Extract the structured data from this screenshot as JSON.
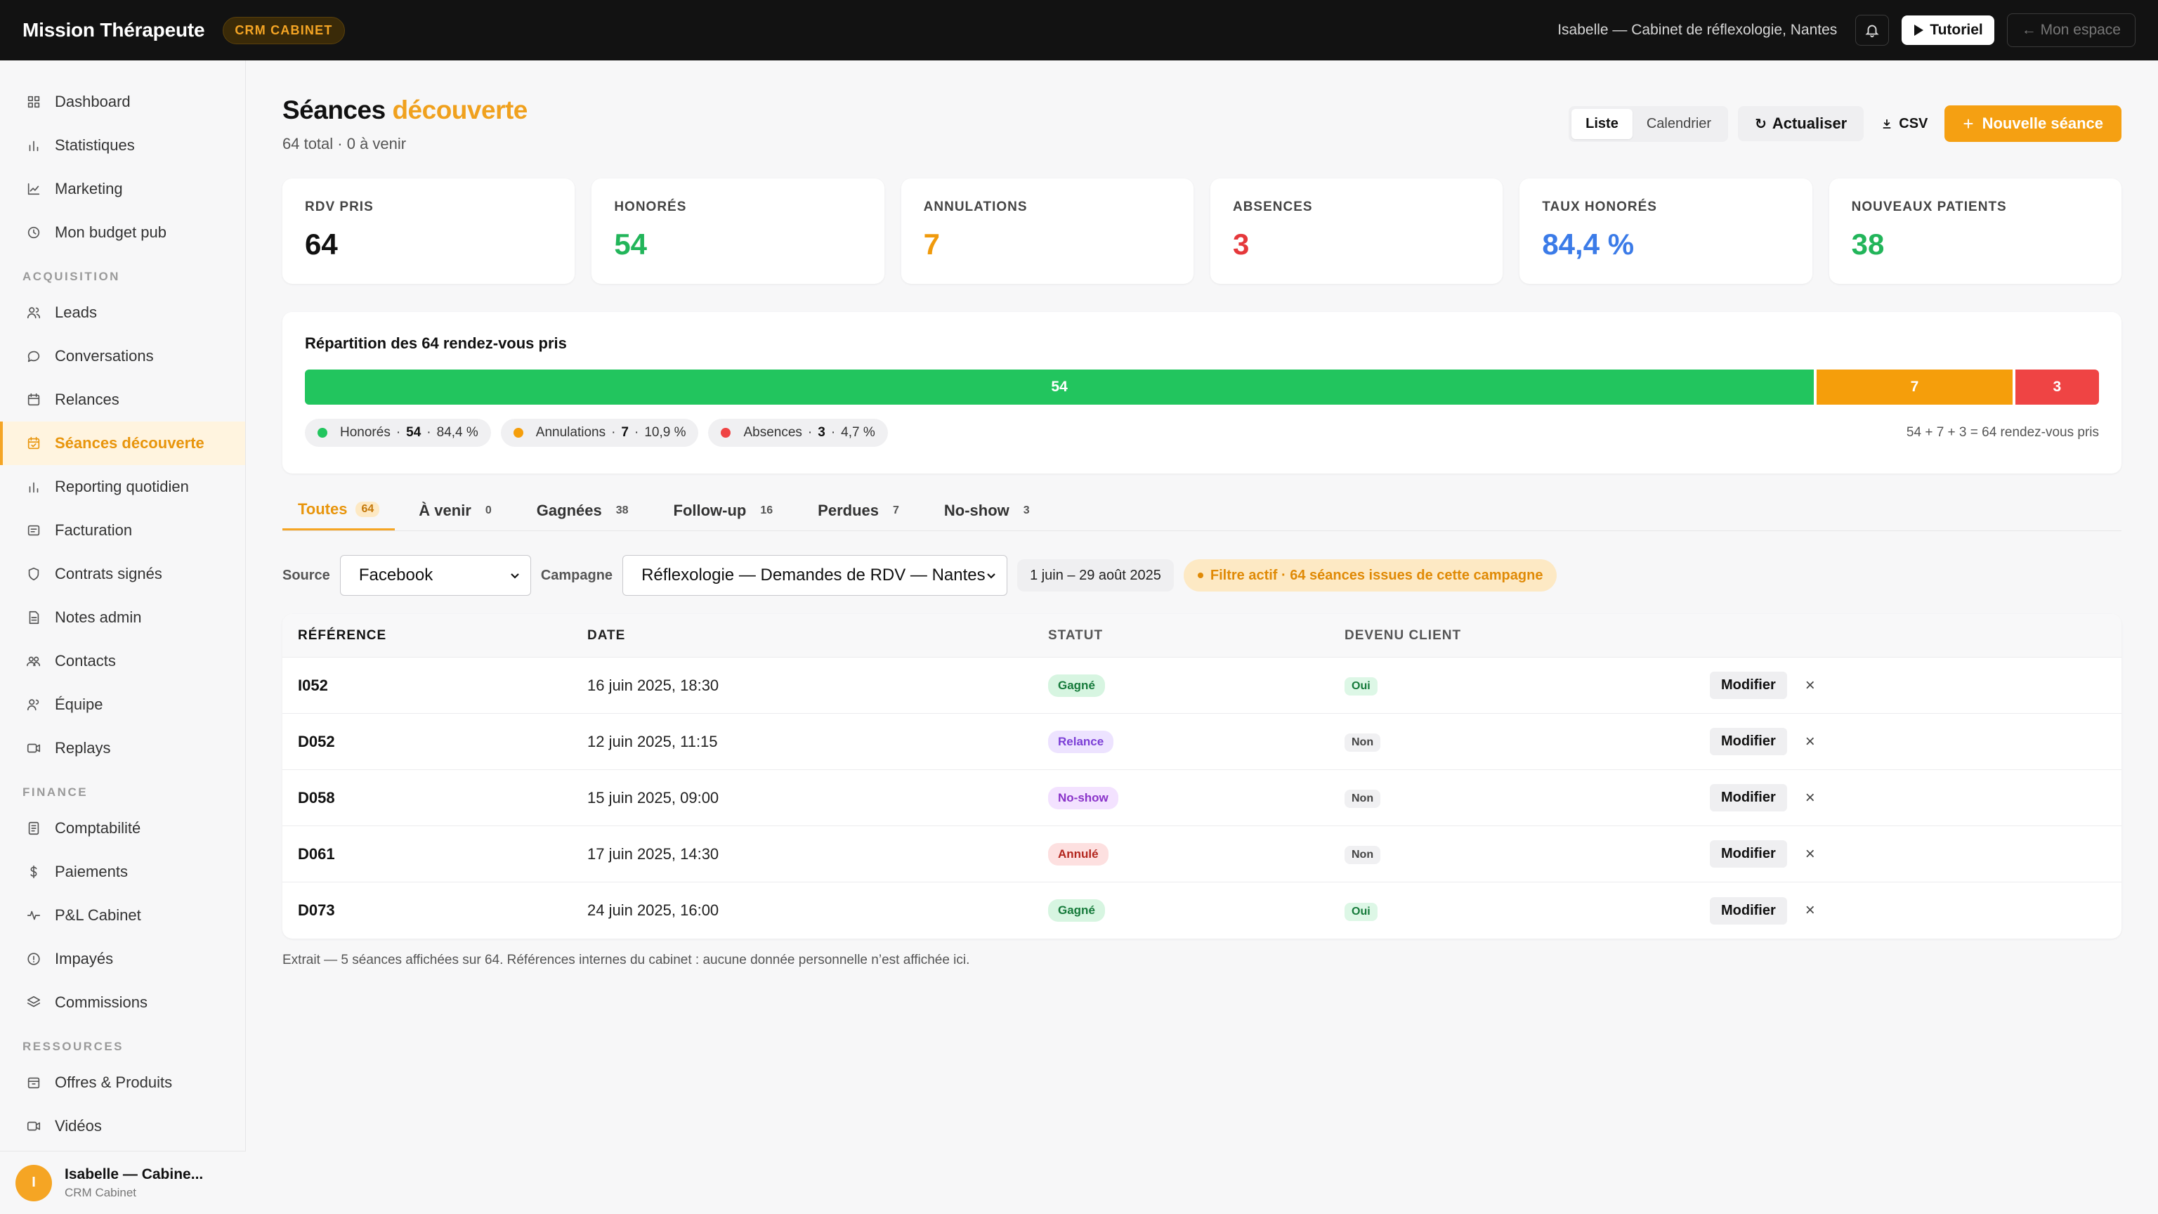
{
  "topbar": {
    "brand": "Mission Thérapeute",
    "badge": "CRM CABINET",
    "user_context": "Isabelle — Cabinet de réflexologie, Nantes",
    "tutorial_label": "Tutoriel",
    "space_label": "← Mon espace"
  },
  "sidebar": {
    "items_top": [
      {
        "label": "Dashboard",
        "icon": "grid-icon"
      },
      {
        "label": "Statistiques",
        "icon": "bar-chart-icon"
      },
      {
        "label": "Marketing",
        "icon": "line-chart-icon"
      },
      {
        "label": "Mon budget pub",
        "icon": "clock-icon"
      }
    ],
    "section_acquisition": "ACQUISITION",
    "items_acquisition": [
      {
        "label": "Leads",
        "icon": "users-icon"
      },
      {
        "label": "Conversations",
        "icon": "chat-icon"
      },
      {
        "label": "Relances",
        "icon": "calendar-icon"
      },
      {
        "label": "Séances découverte",
        "icon": "calendar-check-icon",
        "active": true
      },
      {
        "label": "Reporting quotidien",
        "icon": "bar-chart-icon"
      },
      {
        "label": "Facturation",
        "icon": "invoice-icon"
      },
      {
        "label": "Contrats signés",
        "icon": "shield-icon"
      },
      {
        "label": "Notes admin",
        "icon": "document-icon"
      },
      {
        "label": "Contacts",
        "icon": "contacts-icon"
      },
      {
        "label": "Équipe",
        "icon": "team-icon"
      },
      {
        "label": "Replays",
        "icon": "video-icon"
      }
    ],
    "section_finance": "FINANCE",
    "items_finance": [
      {
        "label": "Comptabilité",
        "icon": "ledger-icon"
      },
      {
        "label": "Paiements",
        "icon": "dollar-icon"
      },
      {
        "label": "P&L Cabinet",
        "icon": "pulse-icon"
      },
      {
        "label": "Impayés",
        "icon": "alert-circle-icon"
      },
      {
        "label": "Commissions",
        "icon": "layers-icon"
      }
    ],
    "section_ressources": "RESSOURCES",
    "items_ressources": [
      {
        "label": "Offres & Produits",
        "icon": "package-icon"
      },
      {
        "label": "Vidéos",
        "icon": "video-icon"
      }
    ],
    "footer": {
      "avatar": "I",
      "name": "Isabelle — Cabine...",
      "role": "CRM Cabinet"
    }
  },
  "header": {
    "title": "Séances",
    "title_accent": "découverte",
    "subtitle": "64 total · 0 à venir",
    "view_list": "Liste",
    "view_calendar": "Calendrier",
    "refresh_label": "Actualiser",
    "csv_label": "CSV",
    "new_label": "Nouvelle séance"
  },
  "kpis": [
    {
      "label": "RDV PRIS",
      "value": "64",
      "color": "#111111"
    },
    {
      "label": "HONORÉS",
      "value": "54",
      "color": "#22b55a"
    },
    {
      "label": "ANNULATIONS",
      "value": "7",
      "color": "#f09a0c"
    },
    {
      "label": "ABSENCES",
      "value": "3",
      "color": "#e5383b"
    },
    {
      "label": "TAUX HONORÉS",
      "value": "84,4 %",
      "color": "#3b7be8"
    },
    {
      "label": "NOUVEAUX PATIENTS",
      "value": "38",
      "color": "#22b55a"
    }
  ],
  "breakdown": {
    "title": "Répartition des 64 rendez-vous pris",
    "segments": [
      {
        "value": 54,
        "label": "54",
        "color": "#22c55e"
      },
      {
        "value": 7,
        "label": "7",
        "color": "#f59e0b"
      },
      {
        "value": 3,
        "label": "3",
        "color": "#ef4444"
      }
    ],
    "legend": [
      {
        "name": "Honorés",
        "count": "54",
        "pct": "84,4 %",
        "color": "#22c55e"
      },
      {
        "name": "Annulations",
        "count": "7",
        "pct": "10,9 %",
        "color": "#f59e0b"
      },
      {
        "name": "Absences",
        "count": "3",
        "pct": "4,7 %",
        "color": "#ef4444"
      }
    ],
    "total_text": "54 + 7 + 3 = 64 rendez-vous pris"
  },
  "tabs": [
    {
      "label": "Toutes",
      "count": "64",
      "active": true
    },
    {
      "label": "À venir",
      "count": "0"
    },
    {
      "label": "Gagnées",
      "count": "38"
    },
    {
      "label": "Follow-up",
      "count": "16"
    },
    {
      "label": "Perdues",
      "count": "7"
    },
    {
      "label": "No-show",
      "count": "3"
    }
  ],
  "filters": {
    "source_label": "Source",
    "source_value": "Facebook",
    "campaign_label": "Campagne",
    "campaign_value": "Réflexologie — Demandes de RDV — Nantes",
    "date_range": "1 juin – 29 août 2025",
    "active_filter": "Filtre actif · 64 séances issues de cette campagne"
  },
  "table": {
    "headers": [
      "RÉFÉRENCE",
      "DATE",
      "STATUT",
      "DEVENU CLIENT"
    ],
    "edit_label": "Modifier",
    "rows": [
      {
        "ref": "I052",
        "date": "16 juin 2025, 18:30",
        "status": "Gagné",
        "status_kind": "gagne",
        "client": "Oui",
        "client_kind": "yes"
      },
      {
        "ref": "D052",
        "date": "12 juin 2025, 11:15",
        "status": "Relance",
        "status_kind": "relance",
        "client": "Non",
        "client_kind": "no"
      },
      {
        "ref": "D058",
        "date": "15 juin 2025, 09:00",
        "status": "No-show",
        "status_kind": "noshow",
        "client": "Non",
        "client_kind": "no"
      },
      {
        "ref": "D061",
        "date": "17 juin 2025, 14:30",
        "status": "Annulé",
        "status_kind": "annule",
        "client": "Non",
        "client_kind": "no"
      },
      {
        "ref": "D073",
        "date": "24 juin 2025, 16:00",
        "status": "Gagné",
        "status_kind": "gagne",
        "client": "Oui",
        "client_kind": "yes"
      }
    ]
  },
  "note": "Extrait — 5 séances affichées sur 64. Références internes du cabinet : aucune donnée personnelle n’est affichée ici."
}
